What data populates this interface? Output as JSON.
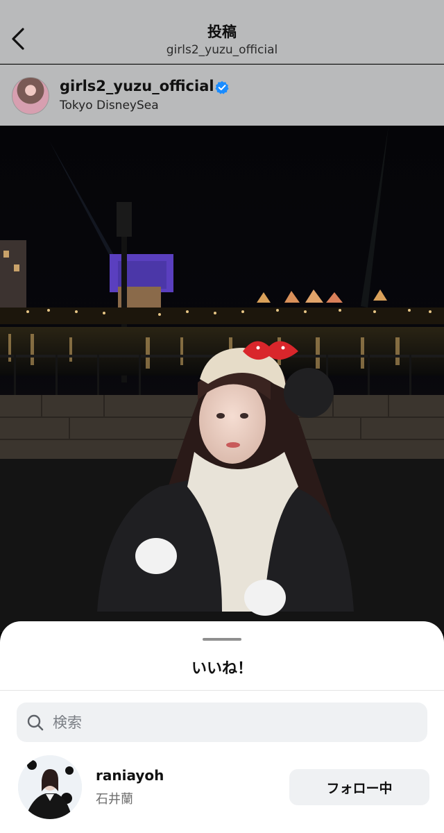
{
  "header": {
    "title": "投稿",
    "subtitle": "girls2_yuzu_official"
  },
  "post": {
    "username": "girls2_yuzu_official",
    "location": "Tokyo DisneySea",
    "verified": true
  },
  "likes_sheet": {
    "title": "いいね！",
    "search": {
      "placeholder": "検索",
      "value": ""
    },
    "users": [
      {
        "handle": "raniayoh",
        "name": "石井蘭",
        "follow_label": "フォロー中"
      }
    ]
  },
  "colors": {
    "dim_header": "#b9babb",
    "verified_blue": "#1a8cff",
    "button_bg": "#eff1f3"
  }
}
